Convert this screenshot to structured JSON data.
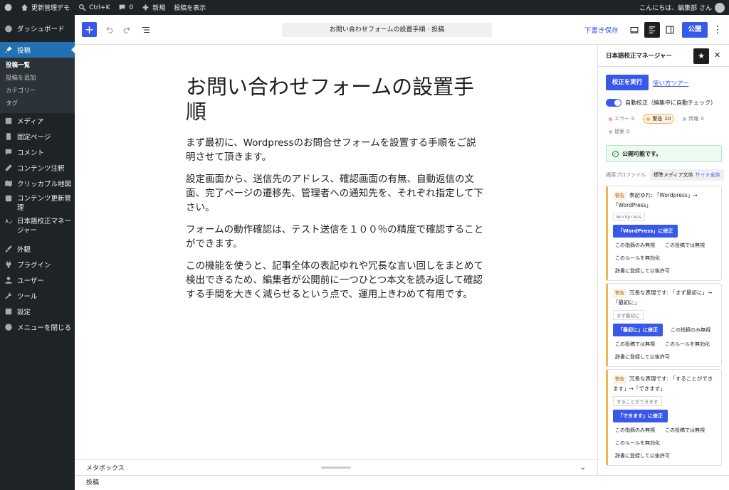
{
  "adminbar": {
    "site_name": "更新管理デモ",
    "shortcut": "Ctrl+K",
    "comments_count": "0",
    "new_label": "新規",
    "view_post": "投稿を表示",
    "greeting": "こんにちは、編集部 さん"
  },
  "sidebar": {
    "dashboard": "ダッシュボード",
    "posts": "投稿",
    "posts_sub": [
      "投稿一覧",
      "投稿を追加",
      "カテゴリー",
      "タグ"
    ],
    "media": "メディア",
    "pages": "固定ページ",
    "comments": "コメント",
    "annotation": "コンテンツ注釈",
    "clickable_map": "クリッカブル地図",
    "content_update": "コンテンツ更新管理",
    "proofreading": "日本語校正マネージャー",
    "appearance": "外観",
    "plugins": "プラグイン",
    "users": "ユーザー",
    "tools": "ツール",
    "settings": "設定",
    "collapse": "メニューを閉じる"
  },
  "toolbar": {
    "doc_title": "お問い合わせフォームの設置手順 · 投稿",
    "save_draft": "下書き保存",
    "publish": "公開"
  },
  "post": {
    "title": "お問い合わせフォームの設置手順",
    "paragraphs": [
      "まず最初に、Wordpressのお問合せフォームを設置する手順をご説明させて頂きます。",
      "設定画面から、送信先のアドレス、確認画面の有無、自動返信の文面、完了ページの遷移先、管理者への通知先を、それぞれ指定して下さい。",
      "フォームの動作確認は、テスト送信を１００％の精度で確認することができます。",
      "この機能を使うと、記事全体の表記ゆれや冗長な言い回しをまとめて検出できるため、編集者が公開前に一つひとつ本文を読み返して確認する手間を大きく減らせるという点で、運用上きわめて有用です。"
    ]
  },
  "metabox": {
    "label": "メタボックス"
  },
  "footer": {
    "label": "投稿"
  },
  "panel": {
    "title": "日本語校正マネージャー",
    "run": "校正を実行",
    "tour": "使い方ツアー",
    "auto_check": "自動校正（編集中に自動チェック）",
    "counts": {
      "error_label": "エラー",
      "error_value": "0",
      "warn_label": "警告",
      "warn_value": "10",
      "info_label": "情報",
      "info_value": "0",
      "suggest_label": "提案",
      "suggest_value": "0"
    },
    "status_ok": "公開可能です。",
    "profile_label": "適用プロファイル",
    "profile_name": "標準メディア文体",
    "profile_scope": "サイト全体",
    "issues": [
      {
        "level": "警告",
        "message": "表記ゆれ: 「Wordpress」→「WordPress」",
        "snippet": "Wordpress",
        "fix": "「WordPress」に修正",
        "actions": [
          "この指摘のみ無視",
          "この投稿では無視",
          "このルールを無効化",
          "辞書に登録して以後許可"
        ]
      },
      {
        "level": "警告",
        "message": "冗長な表現です: 「まず最初に」→「最初に」",
        "snippet": "まず最初に",
        "fix": "「最初に」に修正",
        "actions": [
          "この指摘のみ無視",
          "この投稿では無視",
          "このルールを無効化",
          "辞書に登録して以後許可"
        ]
      },
      {
        "level": "警告",
        "message": "冗長な表現です: 「することができます」→「できます」",
        "snippet": "することができます",
        "fix": "「できます」に修正",
        "actions": [
          "この指摘のみ無視",
          "この投稿では無視",
          "このルールを無効化",
          "辞書に登録して以後許可"
        ]
      }
    ]
  },
  "colors": {
    "accent": "#3858e9",
    "admin_bg": "#1d2327",
    "active_menu": "#2271b1",
    "warning": "#f0b849"
  }
}
